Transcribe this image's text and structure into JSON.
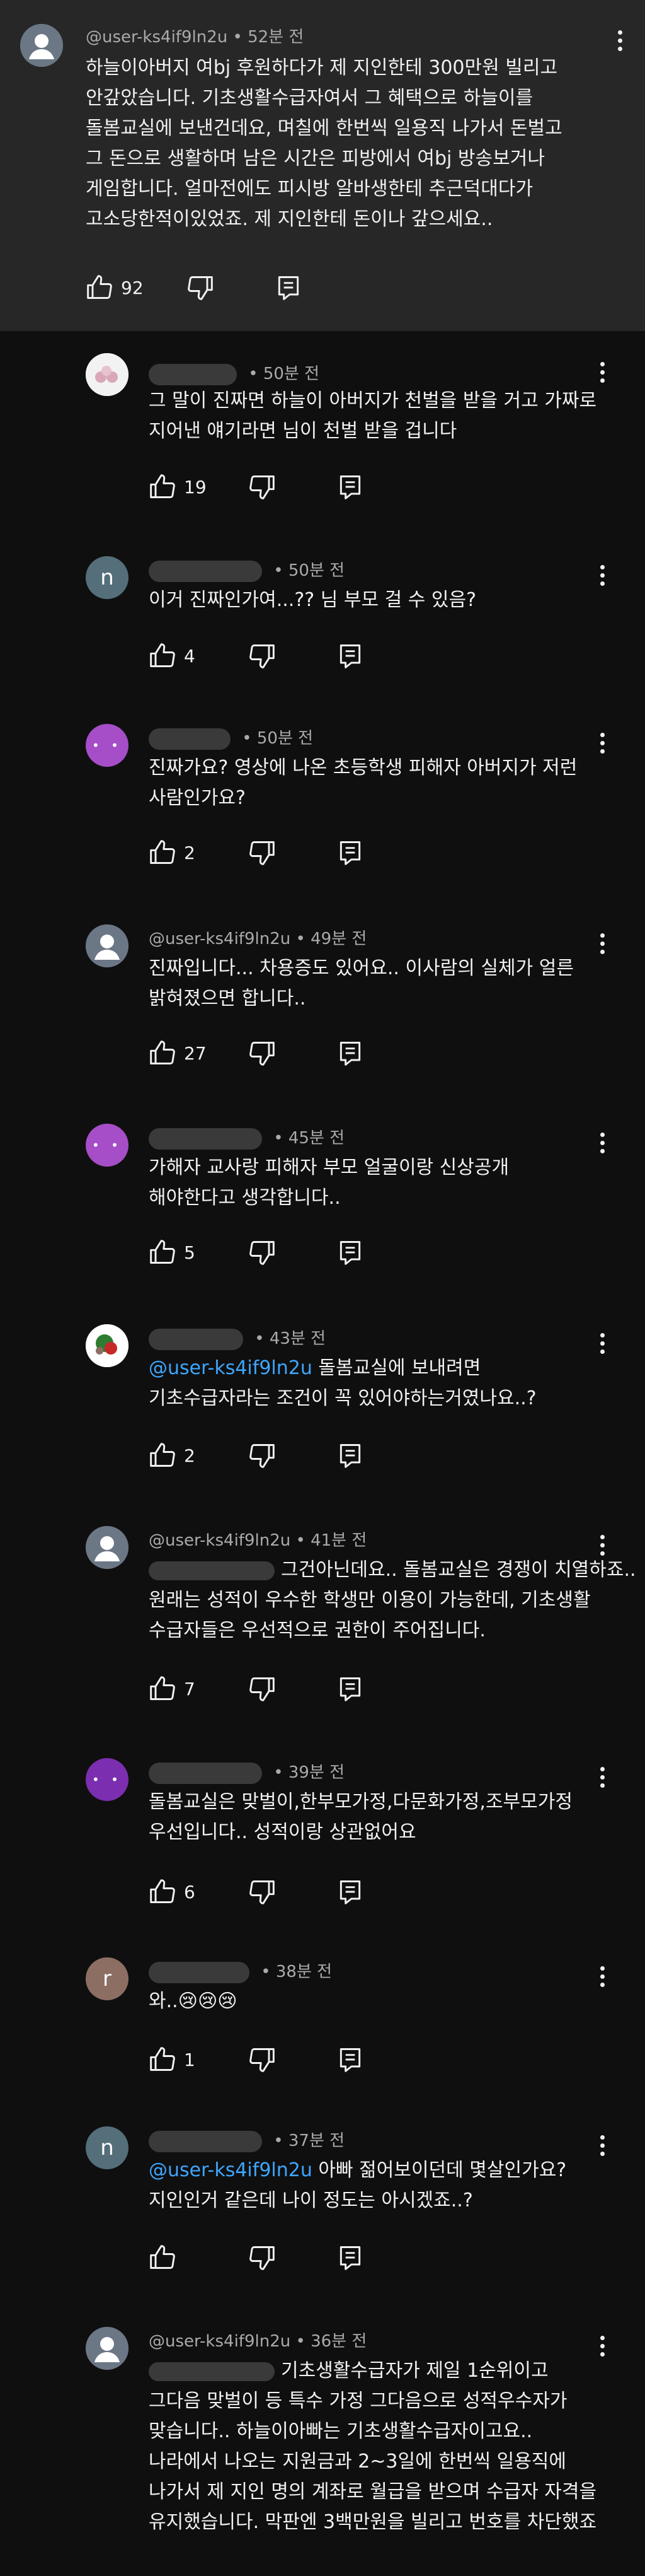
{
  "comments": [
    {
      "author": "@user-ks4if9ln2u",
      "time": "52분 전",
      "avatar": "default",
      "lines": [
        "하늘이아버지 여bj 후원하다가 제 지인한테 300만원 빌리고",
        "안갚았습니다. 기초생활수급자여서 그 혜택으로 하늘이를",
        "돌봄교실에 보낸건데요, 며칠에 한번씩 일용직 나가서 돈벌고",
        "그 돈으로 생활하며 남은 시간은 피방에서 여bj 방송보거나",
        "게임합니다. 얼마전에도 피시방 알바생한테 추근덕대다가",
        "고소당한적이있었죠. 제 지인한테 돈이나 갚으세요.."
      ],
      "likes": "92"
    },
    {
      "author": "",
      "time": "50분 전",
      "avatar": "photo",
      "lines": [
        "그 말이 진짜면 하늘이 아버지가 천벌을 받을 거고 가짜로",
        "지어낸 얘기라면 님이 천벌 받을 겁니다"
      ],
      "likes": "19"
    },
    {
      "author": "",
      "time": "50분 전",
      "avatar": "n",
      "avatar_color": "#546e7a",
      "lines": [
        "이거 진짜인가여...?? 님 부모 걸 수 있음?"
      ],
      "likes": "4"
    },
    {
      "author": "",
      "time": "50분 전",
      "avatar": "dots",
      "avatar_color": "#a64dc8",
      "lines": [
        "진짜가요? 영상에 나온 초등학생 피해자 아버지가 저런",
        "사람인가요?"
      ],
      "likes": "2"
    },
    {
      "author": "@user-ks4if9ln2u",
      "time": "49분 전",
      "avatar": "default",
      "lines": [
        "진짜입니다... 차용증도 있어요.. 이사람의 실체가 얼른",
        "밝혀졌으면 합니다.."
      ],
      "likes": "27"
    },
    {
      "author": "",
      "time": "45분 전",
      "avatar": "dots",
      "avatar_color": "#a64dc8",
      "lines": [
        "가해자 교사랑 피해자 부모 얼굴이랑 신상공개",
        "해야한다고 생각합니다.."
      ],
      "likes": "5"
    },
    {
      "author": "",
      "time": "43분 전",
      "avatar": "photo2",
      "mention": "@user-ks4if9ln2u",
      "lines": [
        "돌봄교실에 보내려면",
        "기초수급자라는 조건이 꼭 있어야하는거였나요..?"
      ],
      "likes": "2"
    },
    {
      "author": "@user-ks4if9ln2u",
      "time": "41분 전",
      "avatar": "default",
      "lines": [
        "그건아닌데요.. 돌봄교실은 경쟁이 치열하죠..",
        "원래는 성적이 우수한 학생만 이용이 가능한데, 기초생활",
        "수급자들은 우선적으로 권한이 주어집니다."
      ],
      "likes": "7"
    },
    {
      "author": "",
      "time": "39분 전",
      "avatar": "dots",
      "avatar_color": "#7b2fb0",
      "lines": [
        "돌봄교실은 맞벌이,한부모가정,다문화가정,조부모가정",
        "우선입니다.. 성적이랑 상관없어요"
      ],
      "likes": "6"
    },
    {
      "author": "",
      "time": "38분 전",
      "avatar": "r",
      "avatar_color": "#8d6e63",
      "lines": [
        "와..😢😢😢"
      ],
      "likes": "1"
    },
    {
      "author": "",
      "time": "37분 전",
      "avatar": "n",
      "avatar_color": "#546e7a",
      "mention": "@user-ks4if9ln2u",
      "lines": [
        "아빠 젊어보이던데 몇살인가요?",
        "지인인거 같은데 나이 정도는 아시겠죠..?"
      ],
      "likes": ""
    },
    {
      "author": "@user-ks4if9ln2u",
      "time": "36분 전",
      "avatar": "default",
      "lines": [
        "기초생활수급자가 제일 1순위이고",
        "그다음 맞벌이 등 특수 가정 그다음으로 성적우수자가",
        "맞습니다.. 하늘이아빠는 기초생활수급자이고요..",
        "나라에서 나오는 지원금과 2~3일에 한번씩 일용직에",
        "나가서 제 지인 명의 계좌로 월급을 받으며 수급자 자격을",
        "유지했습니다. 막판엔 3백만원을 빌리고 번호를 차단했죠"
      ],
      "likes": ""
    }
  ]
}
